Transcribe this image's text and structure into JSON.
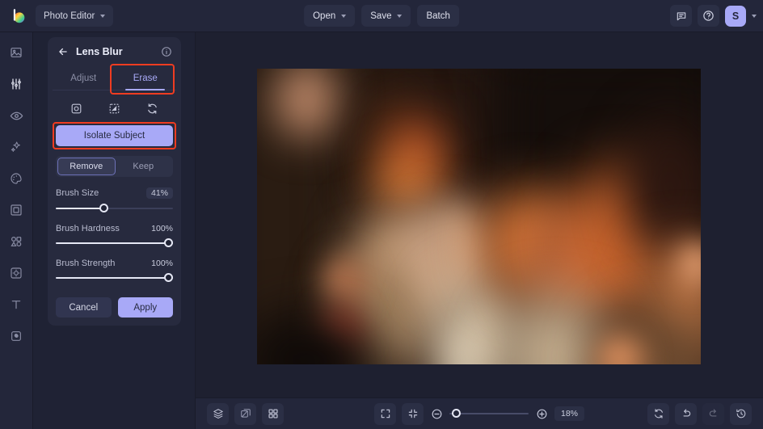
{
  "header": {
    "logo_icon": "brand-logo-icon",
    "mode_label": "Photo Editor",
    "open_label": "Open",
    "save_label": "Save",
    "batch_label": "Batch",
    "chat_icon": "chat-bubble-icon",
    "help_icon": "help-circle-icon",
    "avatar_initial": "S"
  },
  "sidebar": {
    "items": [
      {
        "name": "image",
        "icon": "image-icon",
        "active": false
      },
      {
        "name": "adjust",
        "icon": "sliders-icon",
        "active": true
      },
      {
        "name": "retouch",
        "icon": "eye-icon",
        "active": false
      },
      {
        "name": "effects",
        "icon": "sparkles-icon",
        "active": false
      },
      {
        "name": "color",
        "icon": "palette-icon",
        "active": false
      },
      {
        "name": "frame",
        "icon": "frame-icon",
        "active": false
      },
      {
        "name": "shapes",
        "icon": "shapes-icon",
        "active": false
      },
      {
        "name": "overlay",
        "icon": "overlay-icon",
        "active": false
      },
      {
        "name": "text",
        "icon": "text-icon",
        "active": false
      },
      {
        "name": "layers",
        "icon": "layers-icon",
        "active": false
      }
    ]
  },
  "panel": {
    "back_icon": "back-arrow-icon",
    "title": "Lens Blur",
    "info_icon": "info-circle-icon",
    "tabs": [
      {
        "label": "Adjust",
        "active": false
      },
      {
        "label": "Erase",
        "active": true
      }
    ],
    "tools": [
      {
        "name": "subject-mask",
        "icon": "subject-mask-icon"
      },
      {
        "name": "invert-mask",
        "icon": "invert-mask-icon"
      },
      {
        "name": "reset-mask",
        "icon": "reset-icon"
      }
    ],
    "isolate_label": "Isolate Subject",
    "mode_toggle": [
      {
        "label": "Remove",
        "active": true
      },
      {
        "label": "Keep",
        "active": false
      }
    ],
    "sliders": [
      {
        "label": "Brush Size",
        "value": "41%",
        "percent": 41,
        "pill": true
      },
      {
        "label": "Brush Hardness",
        "value": "100%",
        "percent": 100,
        "pill": false
      },
      {
        "label": "Brush Strength",
        "value": "100%",
        "percent": 100,
        "pill": false
      }
    ],
    "cancel_label": "Cancel",
    "apply_label": "Apply",
    "accent_color": "#a8a9f7",
    "annotation_color": "#ef3c21"
  },
  "bottombar": {
    "left_icons": [
      {
        "name": "layers",
        "icon": "layers-stack-icon"
      },
      {
        "name": "compare",
        "icon": "compare-icon"
      },
      {
        "name": "grid",
        "icon": "grid-icon"
      }
    ],
    "fit_icon": "fit-screen-icon",
    "collapse_icon": "collapse-icon",
    "zoom_out_icon": "zoom-out-icon",
    "zoom_in_icon": "zoom-in-icon",
    "zoom_level": "18%",
    "zoom_percent": 6,
    "right_icons": [
      {
        "name": "reset-view",
        "icon": "reset-view-icon",
        "dim": false
      },
      {
        "name": "undo",
        "icon": "undo-icon",
        "dim": false
      },
      {
        "name": "redo",
        "icon": "redo-icon",
        "dim": true
      },
      {
        "name": "history",
        "icon": "history-icon",
        "dim": false
      }
    ]
  },
  "canvas": {
    "description": "blurred-photo-preview"
  }
}
